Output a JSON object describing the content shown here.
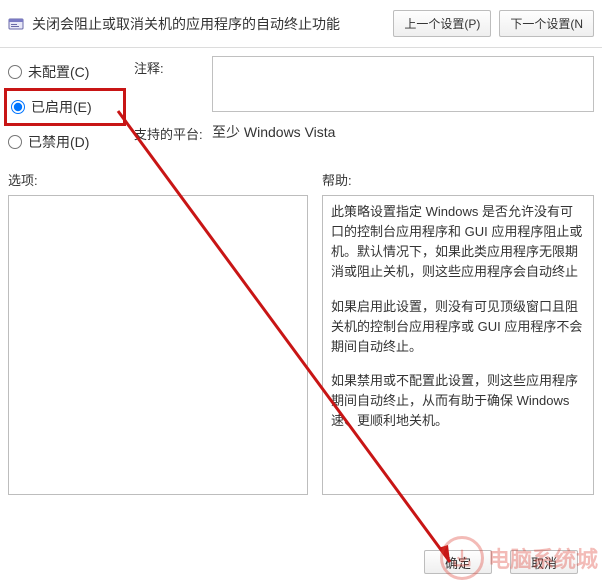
{
  "header": {
    "title": "关闭会阻止或取消关机的应用程序的自动终止功能",
    "prev_btn": "上一个设置(P)",
    "next_btn": "下一个设置(N"
  },
  "radios": {
    "unconfigured": "未配置(C)",
    "enabled": "已启用(E)",
    "disabled": "已禁用(D)"
  },
  "labels": {
    "comment": "注释:",
    "platform": "支持的平台:",
    "options": "选项:",
    "help": "帮助:"
  },
  "platform_value": "至少 Windows Vista",
  "help_text": {
    "p1": "此策略设置指定 Windows 是否允许没有可口的控制台应用程序和 GUI 应用程序阻止或机。默认情况下，如果此类应用程序无限期消或阻止关机，则这些应用程序会自动终止",
    "p2": "如果启用此设置，则没有可见顶级窗口且阻关机的控制台应用程序或 GUI 应用程序不会期间自动终止。",
    "p3": "如果禁用或不配置此设置，则这些应用程序期间自动终止，从而有助于确保 Windows 速、更顺利地关机。"
  },
  "buttons": {
    "ok": "确定",
    "cancel": "取消"
  },
  "watermark": "电脑系统城"
}
